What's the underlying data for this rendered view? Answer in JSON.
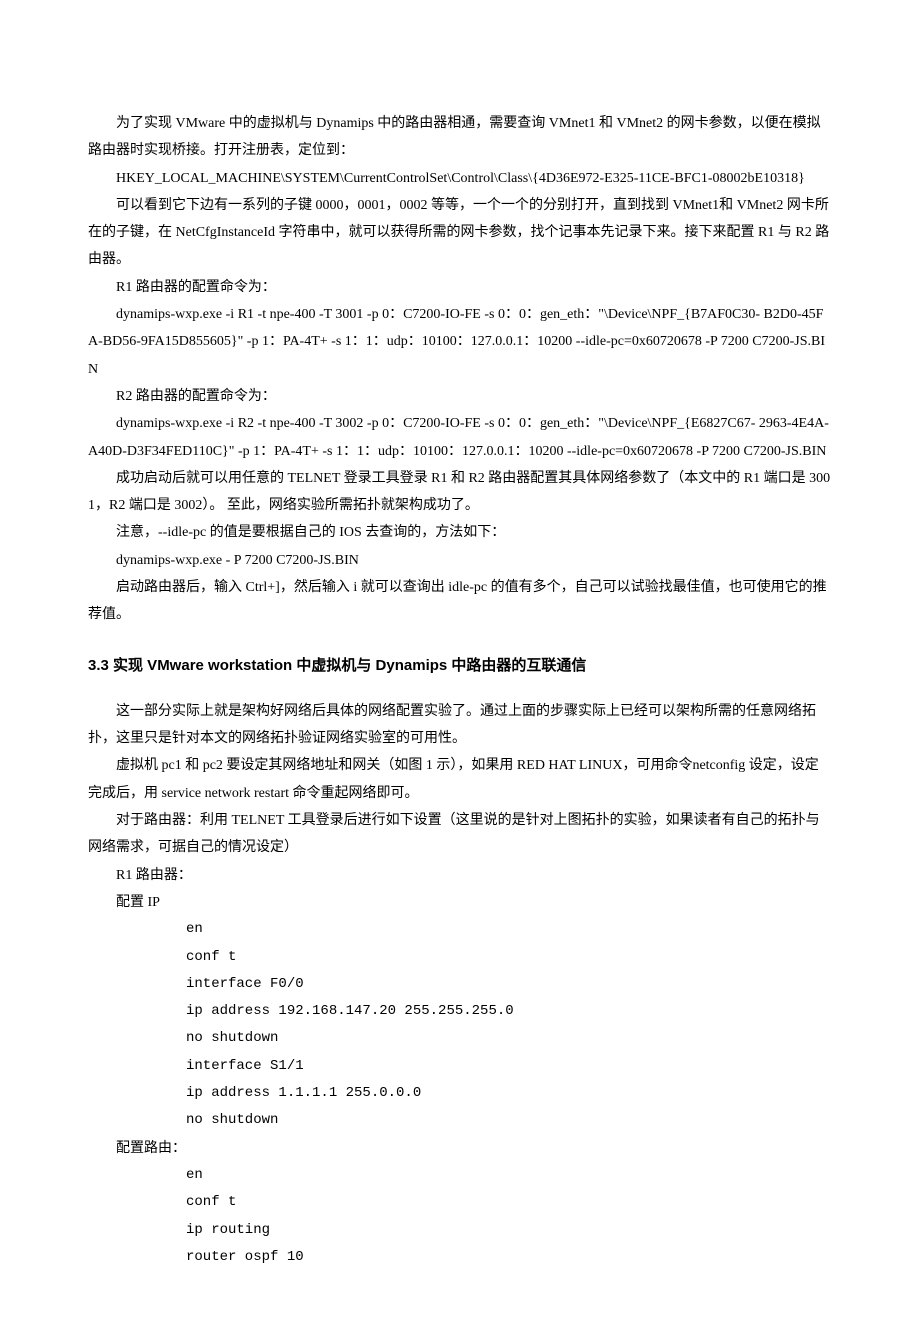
{
  "p1": "为了实现 VMware 中的虚拟机与 Dynamips 中的路由器相通，需要查询 VMnet1 和 VMnet2 的网卡参数，以便在模拟路由器时实现桥接。打开注册表，定位到：",
  "p2": "HKEY_LOCAL_MACHINE\\SYSTEM\\CurrentControlSet\\Control\\Class\\{4D36E972-E325-11CE-BFC1-08002bE10318}",
  "p3": "可以看到它下边有一系列的子键 0000，0001，0002 等等，一个一个的分别打开，直到找到 VMnet1和 VMnet2 网卡所在的子键，在 NetCfgInstanceId 字符串中，就可以获得所需的网卡参数，找个记事本先记录下来。接下来配置 R1 与 R2 路由器。",
  "p4": "R1 路由器的配置命令为：",
  "p5": "dynamips-wxp.exe -i R1 -t npe-400 -T 3001 -p 0：C7200-IO-FE -s 0：0：gen_eth：\"\\Device\\NPF_{B7AF0C30- B2D0-45FA-BD56-9FA15D855605}\" -p 1：PA-4T+ -s 1：1：udp：10100：127.0.0.1：10200 --idle-pc=0x60720678 -P 7200 C7200-JS.BIN",
  "p6": "R2 路由器的配置命令为：",
  "p7": "dynamips-wxp.exe -i R2 -t npe-400 -T 3002 -p 0：C7200-IO-FE -s 0：0：gen_eth：\"\\Device\\NPF_{E6827C67- 2963-4E4A-A40D-D3F34FED110C}\" -p 1：PA-4T+ -s 1：1：udp：10100：127.0.0.1：10200 --idle-pc=0x60720678 -P 7200 C7200-JS.BIN",
  "p8": "成功启动后就可以用任意的 TELNET 登录工具登录 R1 和 R2 路由器配置其具体网络参数了（本文中的 R1 端口是 3001，R2 端口是 3002）。 至此，网络实验所需拓扑就架构成功了。",
  "p9": "注意，--idle-pc 的值是要根据自己的 IOS 去查询的，方法如下：",
  "p10": "dynamips-wxp.exe  - P 7200 C7200-JS.BIN",
  "p11": "启动路由器后，输入 Ctrl+]，然后输入 i 就可以查询出 idle-pc 的值有多个，自己可以试验找最佳值，也可使用它的推荐值。",
  "h1": "3.3   实现 VMware workstation 中虚拟机与 Dynamips 中路由器的互联通信",
  "p12": "这一部分实际上就是架构好网络后具体的网络配置实验了。通过上面的步骤实际上已经可以架构所需的任意网络拓扑，这里只是针对本文的网络拓扑验证网络实验室的可用性。",
  "p13": "虚拟机 pc1 和 pc2 要设定其网络地址和网关（如图 1 示），如果用 RED HAT LINUX，可用命令netconfig 设定，设定完成后，用 service network restart 命令重起网络即可。",
  "p14": "对于路由器：利用 TELNET 工具登录后进行如下设置（这里说的是针对上图拓扑的实验，如果读者有自己的拓扑与网络需求，可据自己的情况设定）",
  "p15": "R1 路由器：",
  "p16": "配置 IP",
  "c1": "en",
  "c2": "conf   t",
  "c3": "interface   F0/0",
  "c4": "ip   address   192.168.147.20   255.255.255.0",
  "c5": "no   shutdown",
  "c6": "interface   S1/1",
  "c7": "ip   address   1.1.1.1   255.0.0.0",
  "c8": "no   shutdown",
  "p17": "配置路由：",
  "c9": "en",
  "c10": "conf   t",
  "c11": "ip   routing",
  "c12": "router   ospf   10"
}
